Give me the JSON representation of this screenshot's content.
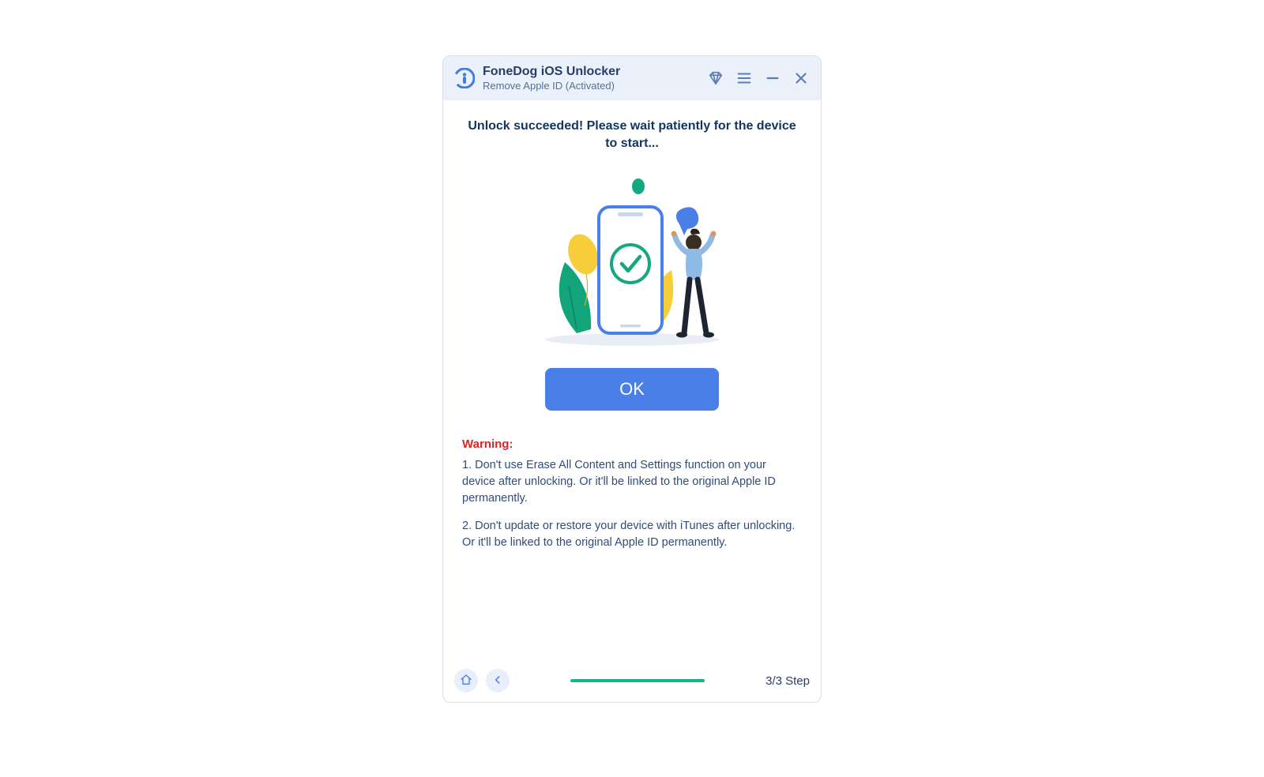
{
  "header": {
    "title": "FoneDog iOS Unlocker",
    "subtitle": "Remove Apple ID  (Activated)"
  },
  "main": {
    "headline": "Unlock succeeded! Please wait patiently for the device to start...",
    "ok_label": "OK"
  },
  "warning": {
    "label": "Warning:",
    "item1": "1. Don't use Erase All Content and Settings function on your device after unlocking. Or it'll be linked to the original Apple ID permanently.",
    "item2": "2. Don't update or restore your device with iTunes after unlocking. Or it'll be linked to the original Apple ID permanently."
  },
  "footer": {
    "step": "3/3 Step"
  },
  "icons": {
    "diamond": "diamond-icon",
    "menu": "menu-icon",
    "minimize": "minimize-icon",
    "close": "close-icon",
    "home": "home-icon",
    "back": "back-icon"
  }
}
